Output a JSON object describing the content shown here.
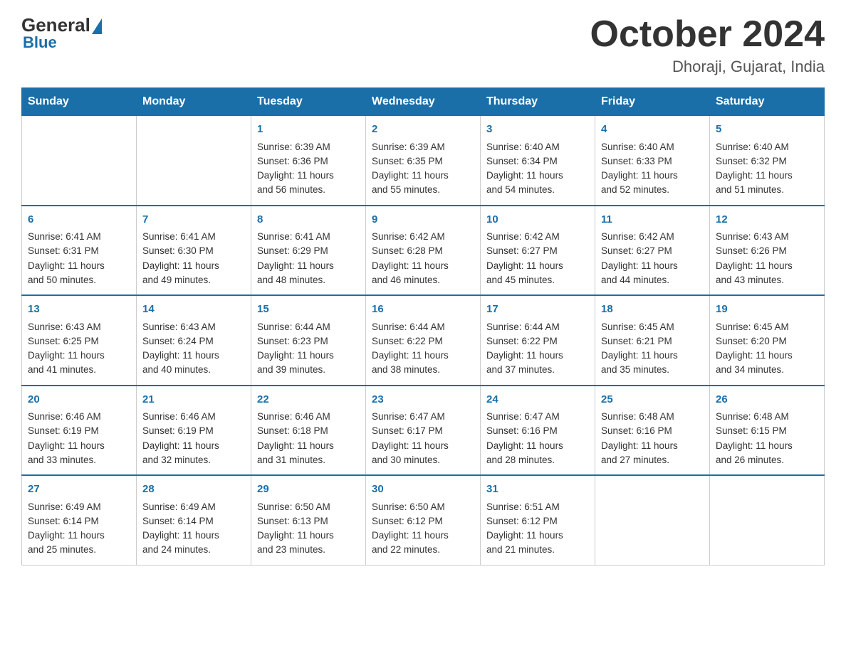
{
  "header": {
    "logo": {
      "general": "General",
      "blue": "Blue"
    },
    "title": "October 2024",
    "location": "Dhoraji, Gujarat, India"
  },
  "calendar": {
    "days_of_week": [
      "Sunday",
      "Monday",
      "Tuesday",
      "Wednesday",
      "Thursday",
      "Friday",
      "Saturday"
    ],
    "weeks": [
      [
        {
          "day": "",
          "info": ""
        },
        {
          "day": "",
          "info": ""
        },
        {
          "day": "1",
          "info": "Sunrise: 6:39 AM\nSunset: 6:36 PM\nDaylight: 11 hours\nand 56 minutes."
        },
        {
          "day": "2",
          "info": "Sunrise: 6:39 AM\nSunset: 6:35 PM\nDaylight: 11 hours\nand 55 minutes."
        },
        {
          "day": "3",
          "info": "Sunrise: 6:40 AM\nSunset: 6:34 PM\nDaylight: 11 hours\nand 54 minutes."
        },
        {
          "day": "4",
          "info": "Sunrise: 6:40 AM\nSunset: 6:33 PM\nDaylight: 11 hours\nand 52 minutes."
        },
        {
          "day": "5",
          "info": "Sunrise: 6:40 AM\nSunset: 6:32 PM\nDaylight: 11 hours\nand 51 minutes."
        }
      ],
      [
        {
          "day": "6",
          "info": "Sunrise: 6:41 AM\nSunset: 6:31 PM\nDaylight: 11 hours\nand 50 minutes."
        },
        {
          "day": "7",
          "info": "Sunrise: 6:41 AM\nSunset: 6:30 PM\nDaylight: 11 hours\nand 49 minutes."
        },
        {
          "day": "8",
          "info": "Sunrise: 6:41 AM\nSunset: 6:29 PM\nDaylight: 11 hours\nand 48 minutes."
        },
        {
          "day": "9",
          "info": "Sunrise: 6:42 AM\nSunset: 6:28 PM\nDaylight: 11 hours\nand 46 minutes."
        },
        {
          "day": "10",
          "info": "Sunrise: 6:42 AM\nSunset: 6:27 PM\nDaylight: 11 hours\nand 45 minutes."
        },
        {
          "day": "11",
          "info": "Sunrise: 6:42 AM\nSunset: 6:27 PM\nDaylight: 11 hours\nand 44 minutes."
        },
        {
          "day": "12",
          "info": "Sunrise: 6:43 AM\nSunset: 6:26 PM\nDaylight: 11 hours\nand 43 minutes."
        }
      ],
      [
        {
          "day": "13",
          "info": "Sunrise: 6:43 AM\nSunset: 6:25 PM\nDaylight: 11 hours\nand 41 minutes."
        },
        {
          "day": "14",
          "info": "Sunrise: 6:43 AM\nSunset: 6:24 PM\nDaylight: 11 hours\nand 40 minutes."
        },
        {
          "day": "15",
          "info": "Sunrise: 6:44 AM\nSunset: 6:23 PM\nDaylight: 11 hours\nand 39 minutes."
        },
        {
          "day": "16",
          "info": "Sunrise: 6:44 AM\nSunset: 6:22 PM\nDaylight: 11 hours\nand 38 minutes."
        },
        {
          "day": "17",
          "info": "Sunrise: 6:44 AM\nSunset: 6:22 PM\nDaylight: 11 hours\nand 37 minutes."
        },
        {
          "day": "18",
          "info": "Sunrise: 6:45 AM\nSunset: 6:21 PM\nDaylight: 11 hours\nand 35 minutes."
        },
        {
          "day": "19",
          "info": "Sunrise: 6:45 AM\nSunset: 6:20 PM\nDaylight: 11 hours\nand 34 minutes."
        }
      ],
      [
        {
          "day": "20",
          "info": "Sunrise: 6:46 AM\nSunset: 6:19 PM\nDaylight: 11 hours\nand 33 minutes."
        },
        {
          "day": "21",
          "info": "Sunrise: 6:46 AM\nSunset: 6:19 PM\nDaylight: 11 hours\nand 32 minutes."
        },
        {
          "day": "22",
          "info": "Sunrise: 6:46 AM\nSunset: 6:18 PM\nDaylight: 11 hours\nand 31 minutes."
        },
        {
          "day": "23",
          "info": "Sunrise: 6:47 AM\nSunset: 6:17 PM\nDaylight: 11 hours\nand 30 minutes."
        },
        {
          "day": "24",
          "info": "Sunrise: 6:47 AM\nSunset: 6:16 PM\nDaylight: 11 hours\nand 28 minutes."
        },
        {
          "day": "25",
          "info": "Sunrise: 6:48 AM\nSunset: 6:16 PM\nDaylight: 11 hours\nand 27 minutes."
        },
        {
          "day": "26",
          "info": "Sunrise: 6:48 AM\nSunset: 6:15 PM\nDaylight: 11 hours\nand 26 minutes."
        }
      ],
      [
        {
          "day": "27",
          "info": "Sunrise: 6:49 AM\nSunset: 6:14 PM\nDaylight: 11 hours\nand 25 minutes."
        },
        {
          "day": "28",
          "info": "Sunrise: 6:49 AM\nSunset: 6:14 PM\nDaylight: 11 hours\nand 24 minutes."
        },
        {
          "day": "29",
          "info": "Sunrise: 6:50 AM\nSunset: 6:13 PM\nDaylight: 11 hours\nand 23 minutes."
        },
        {
          "day": "30",
          "info": "Sunrise: 6:50 AM\nSunset: 6:12 PM\nDaylight: 11 hours\nand 22 minutes."
        },
        {
          "day": "31",
          "info": "Sunrise: 6:51 AM\nSunset: 6:12 PM\nDaylight: 11 hours\nand 21 minutes."
        },
        {
          "day": "",
          "info": ""
        },
        {
          "day": "",
          "info": ""
        }
      ]
    ]
  }
}
